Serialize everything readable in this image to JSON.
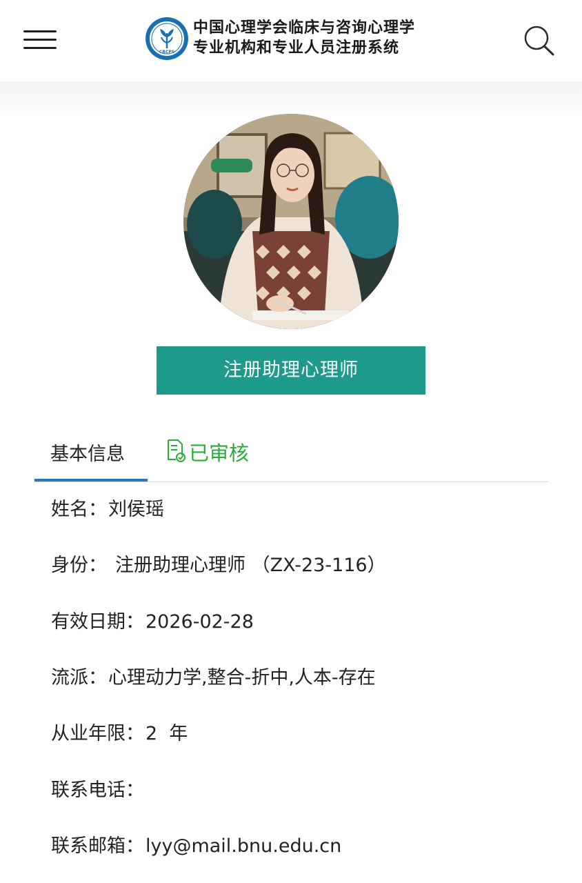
{
  "header": {
    "title_line1": "中国心理学会临床与咨询心理学",
    "title_line2": "专业机构和专业人员注册系统",
    "logo_text": "CRCPS",
    "menu_icon": "hamburger-menu-icon",
    "search_icon": "search-icon"
  },
  "profile": {
    "badge": "注册助理心理师"
  },
  "tabs": {
    "basic_label": "基本信息",
    "status_label": "已审核",
    "status_icon": "verified-document-icon"
  },
  "info": {
    "name_label": "姓名：",
    "name_value": "刘侯瑶",
    "identity_label": "身份：",
    "identity_value": "注册助理心理师 （ZX-23-116）",
    "valid_label": "有效日期：",
    "valid_value": "2026-02-28",
    "school_label": "流派：",
    "school_value": "心理动力学,整合-折中,人本-存在",
    "years_label": "从业年限：",
    "years_value": "2  年",
    "phone_label": "联系电话：",
    "phone_value": "",
    "email_label": "联系邮箱：",
    "email_value": "lyy@mail.bnu.edu.cn"
  },
  "colors": {
    "accent_teal": "#1e9a8a",
    "tab_underline_blue": "#2f78b8",
    "verified_green": "#2bab3b",
    "logo_blue": "#1a6fb0"
  }
}
